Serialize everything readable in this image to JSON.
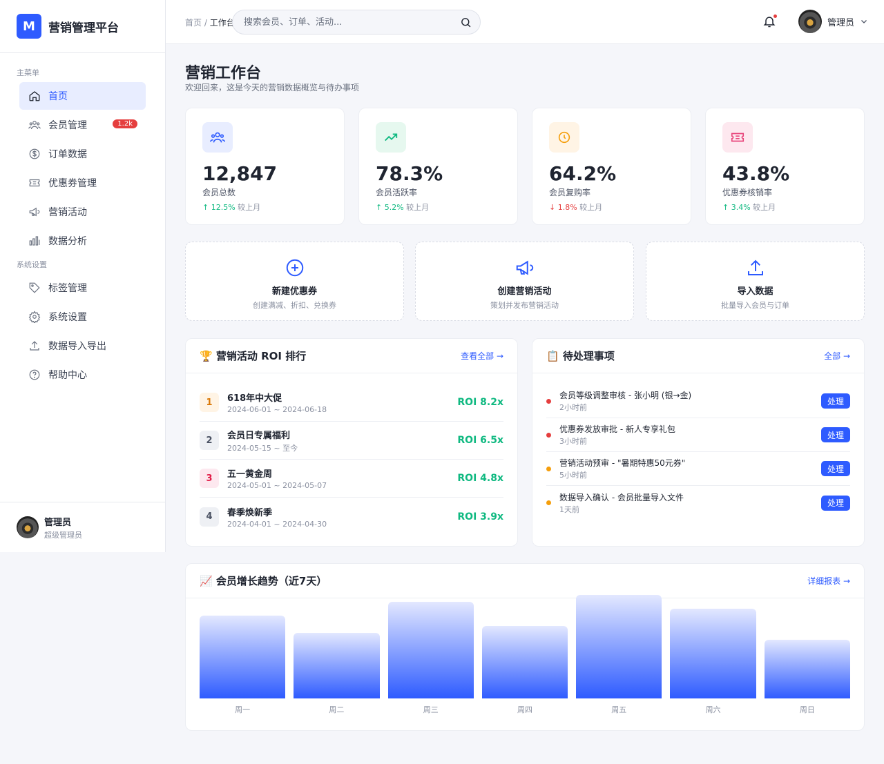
{
  "brand": {
    "logo": "M",
    "name": "营销管理平台"
  },
  "sidebar": {
    "section1": "主菜单",
    "items": [
      {
        "label": "首页",
        "icon": "home-icon",
        "active": true
      },
      {
        "label": "会员管理",
        "icon": "users-icon",
        "badge": "1.2k"
      },
      {
        "label": "订单数据",
        "icon": "dollar-icon"
      },
      {
        "label": "优惠券管理",
        "icon": "ticket-icon"
      },
      {
        "label": "营销活动",
        "icon": "megaphone-icon"
      },
      {
        "label": "数据分析",
        "icon": "bar-chart-icon"
      }
    ],
    "section2": "系统设置",
    "items2": [
      {
        "label": "标签管理",
        "icon": "tag-icon"
      },
      {
        "label": "系统设置",
        "icon": "gear-icon"
      },
      {
        "label": "数据导入导出",
        "icon": "upload-icon"
      },
      {
        "label": "帮助中心",
        "icon": "help-icon"
      }
    ],
    "user": {
      "name": "管理员",
      "role": "超级管理员"
    }
  },
  "header": {
    "breadcrumb_root": "首页",
    "breadcrumb_sep": " / ",
    "breadcrumb_current": "工作台",
    "search_placeholder": "搜索会员、订单、活动...",
    "user_name": "管理员"
  },
  "page": {
    "title": "营销工作台",
    "subtitle": "欢迎回来，这是今天的营销数据概览与待办事项"
  },
  "stats": [
    {
      "value": "12,847",
      "label": "会员总数",
      "trend_dir": "up",
      "trend": "↑ 12.5%",
      "cmp": " 较上月",
      "icon": "users-icon",
      "bg": "#e8edff",
      "color": "#2e5bff"
    },
    {
      "value": "78.3%",
      "label": "会员活跃率",
      "trend_dir": "up",
      "trend": "↑ 5.2%",
      "cmp": " 较上月",
      "icon": "trending-up-icon",
      "bg": "#e6f8ef",
      "color": "#10b981"
    },
    {
      "value": "64.2%",
      "label": "会员复购率",
      "trend_dir": "down",
      "trend": "↓ 1.8%",
      "cmp": " 较上月",
      "icon": "clock-icon",
      "bg": "#fff4e5",
      "color": "#f59e0b"
    },
    {
      "value": "43.8%",
      "label": "优惠券核销率",
      "trend_dir": "up",
      "trend": "↑ 3.4%",
      "cmp": " 较上月",
      "icon": "ticket-icon",
      "bg": "#fde8ef",
      "color": "#e8467c"
    }
  ],
  "actions": [
    {
      "title": "新建优惠券",
      "desc": "创建满减、折扣、兑换券",
      "icon": "plus-circle-icon"
    },
    {
      "title": "创建营销活动",
      "desc": "策划并发布营销活动",
      "icon": "megaphone-icon"
    },
    {
      "title": "导入数据",
      "desc": "批量导入会员与订单",
      "icon": "upload-icon"
    }
  ],
  "roi": {
    "title": "🏆 营销活动 ROI 排行",
    "link": "查看全部 →",
    "rows": [
      {
        "rank": "1",
        "name": "618年中大促",
        "date": "2024-06-01 ~ 2024-06-18",
        "roi": "ROI 8.2x",
        "bg": "#fff4e5",
        "color": "#d97706"
      },
      {
        "rank": "2",
        "name": "会员日专属福利",
        "date": "2024-05-15 ~ 至今",
        "roi": "ROI 6.5x",
        "bg": "#eef0f4",
        "color": "#4b5263"
      },
      {
        "rank": "3",
        "name": "五一黄金周",
        "date": "2024-05-01 ~ 2024-05-07",
        "roi": "ROI 4.8x",
        "bg": "#fde8ef",
        "color": "#e11d48"
      },
      {
        "rank": "4",
        "name": "春季焕新季",
        "date": "2024-04-01 ~ 2024-04-30",
        "roi": "ROI 3.9x",
        "bg": "#eef0f4",
        "color": "#4b5263"
      }
    ]
  },
  "todo": {
    "title": "📋 待处理事项",
    "link": "全部 →",
    "btn": "处理",
    "rows": [
      {
        "title": "会员等级调整审核 - 张小明 (银→金)",
        "time": "2小时前",
        "color": "#e53e3e"
      },
      {
        "title": "优惠券发放审批 - 新人专享礼包",
        "time": "3小时前",
        "color": "#e53e3e"
      },
      {
        "title": "营销活动预审 - \"暑期特惠50元券\"",
        "time": "5小时前",
        "color": "#f59e0b"
      },
      {
        "title": "数据导入确认 - 会员批量导入文件",
        "time": "1天前",
        "color": "#f59e0b"
      }
    ]
  },
  "trend": {
    "title": "📈 会员增长趋势（近7天）",
    "link": "详细报表 →"
  },
  "chart_data": {
    "type": "bar",
    "title": "📈 会员增长趋势（近7天）",
    "categories": [
      "周一",
      "周二",
      "周三",
      "周四",
      "周五",
      "周六",
      "周日"
    ],
    "values": [
      120,
      95,
      140,
      105,
      150,
      130,
      85
    ],
    "ylim": [
      0,
      150
    ]
  }
}
